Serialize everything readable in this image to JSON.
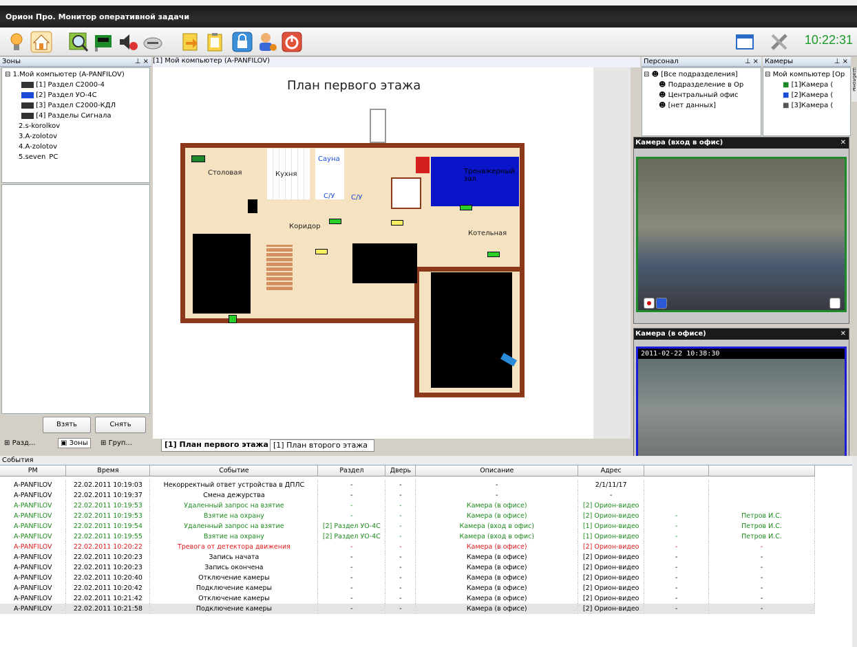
{
  "window": {
    "title": "Орион Про. Монитор оперативной задачи",
    "clock": "10:22:31"
  },
  "zones": {
    "title": "Зоны",
    "tree": [
      "1.Мой компьютер (A-PANFILOV)",
      "[1] Раздел С2000-4",
      "[2] Раздел УО-4С",
      "[3] Раздел С2000-КДЛ",
      "[4] Разделы Сигнала",
      "2.s-korolkov",
      "3.A-zolotov",
      "4.A-zolotov",
      "5.seven_PC"
    ],
    "take_label": "Взять",
    "remove_label": "Снять",
    "tabs": [
      "Разд...",
      "Зоны",
      "Груп..."
    ]
  },
  "plan": {
    "path": "[1] Мой компьютер (A-PANFILOV)",
    "title": "План первого этажа",
    "rooms": {
      "dining": "Столовая",
      "kitchen": "Кухня",
      "sauna": "Сауна",
      "wc1": "С/У",
      "wc2": "С/У",
      "gym": "Тренажерный зал",
      "corridor": "Коридор",
      "boiler": "Котельная"
    },
    "tabs": [
      "[1] План первого этажа",
      "[1] План второго этажа"
    ]
  },
  "personnel": {
    "title": "Персонал",
    "items": [
      "[Все подразделения]",
      "Подразделение в Ор",
      "Центральный офис",
      "[нет данных]"
    ]
  },
  "cameras": {
    "title": "Камеры",
    "items": [
      "Мой компьютер [Ор",
      "[1]Камера (",
      "[2]Камера (",
      "[3]Камера ("
    ],
    "side_tab": "Шаблоны"
  },
  "cam1": {
    "title": "Камера (вход в офис)"
  },
  "cam2": {
    "title": "Камера (в офисе)",
    "timestamp": "2011-02-22 10:38:30"
  },
  "events": {
    "title": "События",
    "columns": [
      "РМ",
      "Время",
      "Событие",
      "Раздел",
      "Дверь",
      "Описание",
      "Адрес",
      "",
      ""
    ],
    "rows": [
      [
        "A-PANFILOV",
        "22.02.2011 10:19:03",
        "Некорректный ответ устройства в ДПЛС",
        "-",
        "-",
        "-",
        "2/1/11/17",
        "",
        ""
      ],
      [
        "A-PANFILOV",
        "22.02.2011 10:19:37",
        "Смена дежурства",
        "-",
        "-",
        "-",
        "-",
        "",
        ""
      ],
      [
        "A-PANFILOV",
        "22.02.2011 10:19:53",
        "Удаленный запрос на взятие",
        "-",
        "-",
        "Камера (в офисе)",
        "[2] Орион-видео",
        "",
        ""
      ],
      [
        "A-PANFILOV",
        "22.02.2011 10:19:53",
        "Взятие на охрану",
        "-",
        "-",
        "Камера (в офисе)",
        "[2] Орион-видео",
        "-",
        "Петров И.С."
      ],
      [
        "A-PANFILOV",
        "22.02.2011 10:19:54",
        "Удаленный запрос на взятие",
        "[2] Раздел УО-4С",
        "-",
        "Камера (вход в офис)",
        "[1] Орион-видео",
        "-",
        "Петров И.С."
      ],
      [
        "A-PANFILOV",
        "22.02.2011 10:19:55",
        "Взятие на охрану",
        "[2] Раздел УО-4С",
        "-",
        "Камера (вход в офис)",
        "[1] Орион-видео",
        "-",
        "Петров И.С."
      ],
      [
        "A-PANFILOV",
        "22.02.2011 10:20:22",
        "Тревога от детектора движения",
        "-",
        "-",
        "Камера (в офисе)",
        "[2] Орион-видео",
        "-",
        "-"
      ],
      [
        "A-PANFILOV",
        "22.02.2011 10:20:23",
        "Запись начата",
        "-",
        "-",
        "Камера (в офисе)",
        "[2] Орион-видео",
        "-",
        "-"
      ],
      [
        "A-PANFILOV",
        "22.02.2011 10:20:23",
        "Запись окончена",
        "-",
        "-",
        "Камера (в офисе)",
        "[2] Орион-видео",
        "-",
        "-"
      ],
      [
        "A-PANFILOV",
        "22.02.2011 10:20:40",
        "Отключение камеры",
        "-",
        "-",
        "Камера (в офисе)",
        "[2] Орион-видео",
        "-",
        "-"
      ],
      [
        "A-PANFILOV",
        "22.02.2011 10:20:42",
        "Подключение камеры",
        "-",
        "-",
        "Камера (в офисе)",
        "[2] Орион-видео",
        "-",
        "-"
      ],
      [
        "A-PANFILOV",
        "22.02.2011 10:21:42",
        "Отключение камеры",
        "-",
        "-",
        "Камера (в офисе)",
        "[2] Орион-видео",
        "-",
        "-"
      ],
      [
        "A-PANFILOV",
        "22.02.2011 10:21:58",
        "Подключение камеры",
        "-",
        "-",
        "Камера (в офисе)",
        "[2] Орион-видео",
        "-",
        "-"
      ]
    ],
    "row_styles": [
      "",
      "",
      "green",
      "green",
      "green",
      "green",
      "red",
      "",
      "",
      "",
      "",
      "",
      "sel"
    ]
  },
  "colors": {
    "accent_green": "#1e8a1e",
    "alarm_red": "#e0191b",
    "clock_green": "#1a9a2a",
    "gym_blue": "#0a14c8"
  },
  "icons": [
    "lamp-icon",
    "home-icon",
    "search-map-icon",
    "board-icon",
    "sound-icon",
    "drive-icon",
    "export-icon",
    "clipboard-icon",
    "lock-icon",
    "user-icon",
    "power-icon",
    "window-icon",
    "tools-icon"
  ]
}
